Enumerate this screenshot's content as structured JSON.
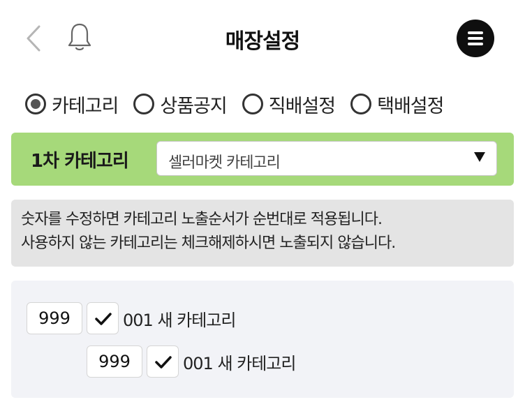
{
  "header": {
    "title": "매장설정",
    "back_icon": "chevron-left-icon",
    "notification_icon": "bell-icon",
    "menu_icon": "hamburger-menu-icon"
  },
  "tabs": [
    {
      "label": "카테고리",
      "checked": true
    },
    {
      "label": "상품공지",
      "checked": false
    },
    {
      "label": "직배설정",
      "checked": false
    },
    {
      "label": "택배설정",
      "checked": false
    }
  ],
  "category_selector": {
    "label": "1차 카테고리",
    "selected": "셀러마켓 카테고리"
  },
  "notice": {
    "line1": "숫자를 수정하면 카테고리 노출순서가 순번대로 적용됩니다.",
    "line2": "사용하지 않는 카테고리는 체크해제하시면 노출되지 않습니다."
  },
  "categories": [
    {
      "order": "999",
      "checked": true,
      "label": "001 새 카테고리"
    },
    {
      "order": "999",
      "checked": true,
      "label": "001 새 카테고리"
    }
  ],
  "colors": {
    "accent_green": "#a6d97a",
    "notice_bg": "#e4e4e4",
    "list_bg": "#f2f3f7"
  }
}
